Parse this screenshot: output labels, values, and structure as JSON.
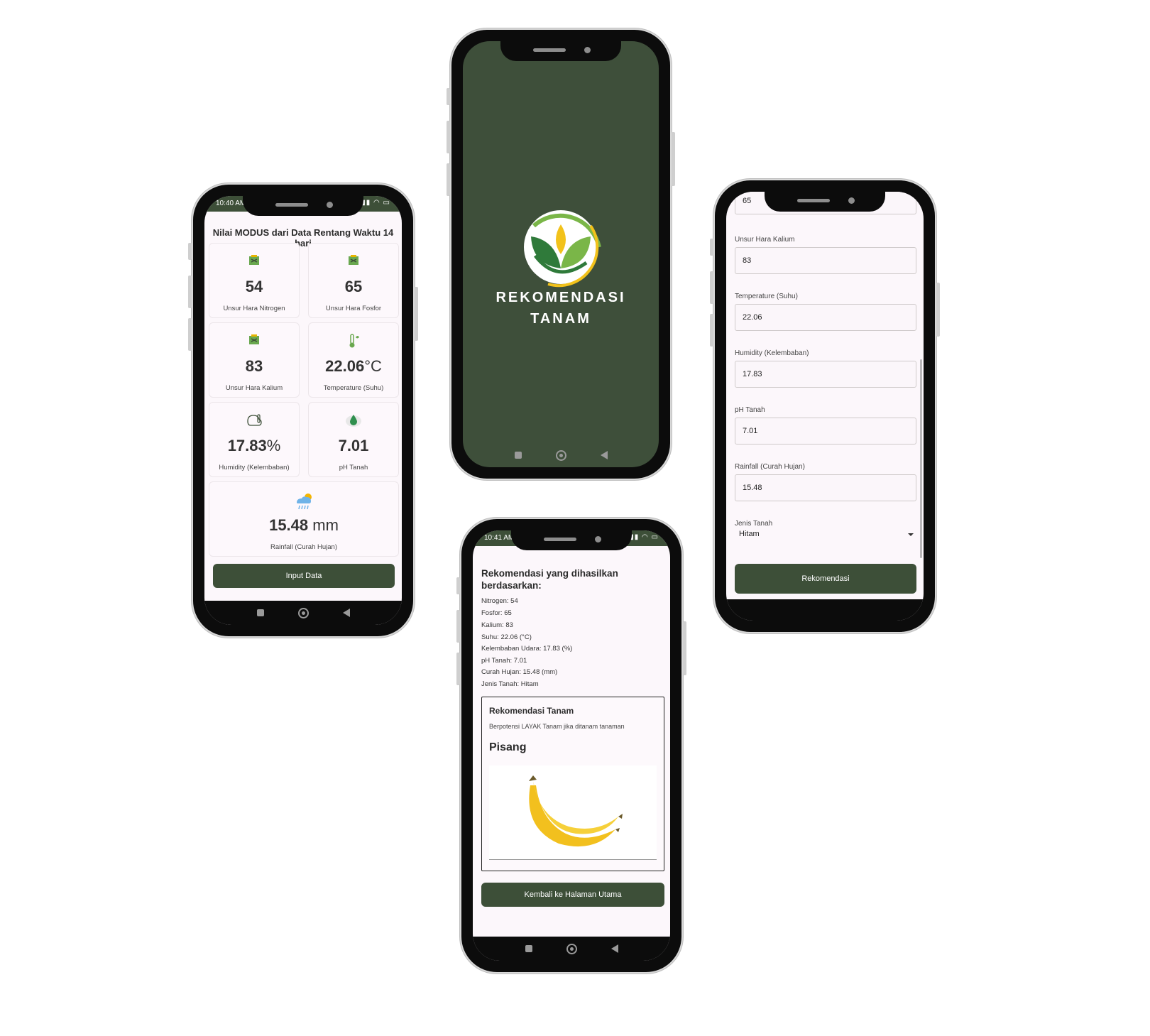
{
  "dashboard": {
    "status_time": "10:40 AM",
    "title": "Nilai MODUS dari Data Rentang Waktu 14 hari",
    "cards": [
      {
        "value": "54",
        "unit": "",
        "label": "Unsur Hara Nitrogen"
      },
      {
        "value": "65",
        "unit": "",
        "label": "Unsur Hara Fosfor"
      },
      {
        "value": "83",
        "unit": "",
        "label": "Unsur Hara Kalium"
      },
      {
        "value": "22.06",
        "unit": "°C",
        "label": "Temperature (Suhu)"
      },
      {
        "value": "17.83",
        "unit": "%",
        "label": "Humidity (Kelembaban)"
      },
      {
        "value": "7.01",
        "unit": "",
        "label": "pH Tanah"
      },
      {
        "value": "15.48",
        "unit": " mm",
        "label": "Rainfall (Curah Hujan)"
      }
    ],
    "button": "Input Data"
  },
  "splash": {
    "line1": "REKOMENDASI",
    "line2": "TANAM",
    "colors": {
      "background": "#3e4f3a",
      "leaf_dark": "#2f7a3a",
      "leaf_light": "#7ab648",
      "leaf_yellow": "#f2c21b"
    }
  },
  "form": {
    "top_value": "65",
    "fields": [
      {
        "label": "Unsur Hara Kalium",
        "value": "83"
      },
      {
        "label": "Temperature (Suhu)",
        "value": "22.06"
      },
      {
        "label": "Humidity (Kelembaban)",
        "value": "17.83"
      },
      {
        "label": "pH Tanah",
        "value": "7.01"
      },
      {
        "label": "Rainfall (Curah Hujan)",
        "value": "15.48"
      }
    ],
    "select_label": "Jenis Tanah",
    "select_value": "Hitam",
    "button": "Rekomendasi"
  },
  "result": {
    "status_time": "10:41 AM",
    "heading": "Rekomendasi yang dihasilkan berdasarkan:",
    "lines": [
      "Nitrogen: 54",
      "Fosfor: 65",
      "Kalium: 83",
      "Suhu: 22.06 (°C)",
      "Kelembaban Udara: 17.83 (%)",
      "pH Tanah: 7.01",
      "Curah Hujan: 15.48 (mm)",
      "Jenis Tanah: Hitam"
    ],
    "box_title": "Rekomendasi Tanam",
    "box_text": "Berpotensi LAYAK Tanam jika ditanam tanaman",
    "crop": "Pisang",
    "button": "Kembali ke Halaman Utama"
  },
  "theme": {
    "primary": "#3d4f38",
    "screen_bg": "#fcf7fb"
  }
}
